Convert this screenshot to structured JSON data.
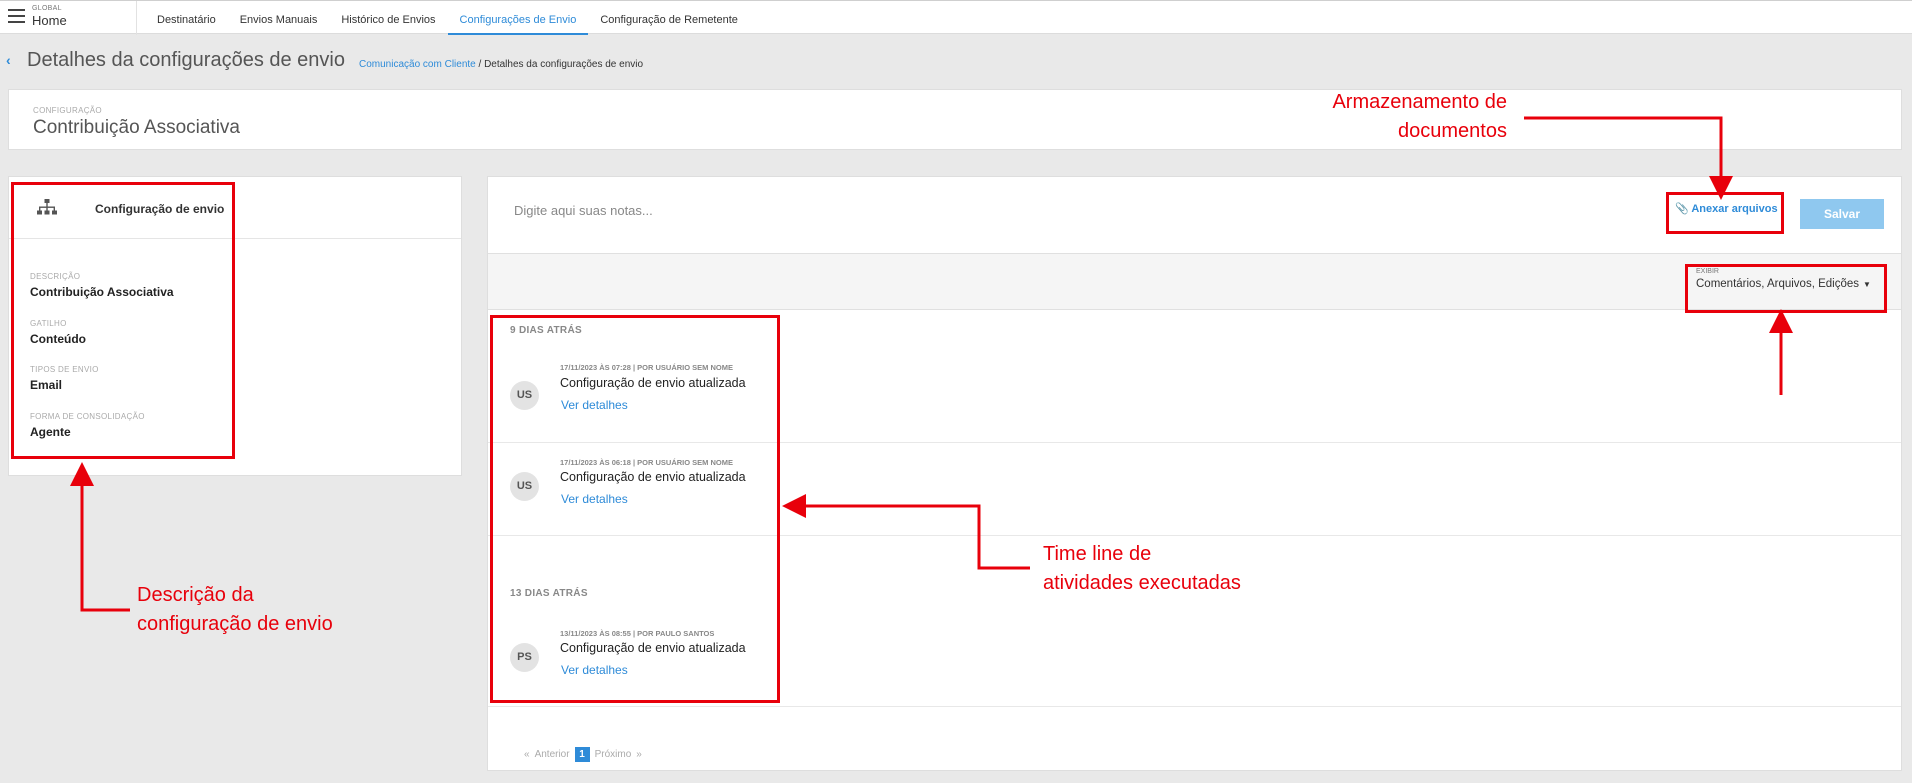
{
  "topbar": {
    "global_label": "GLOBAL",
    "home_label": "Home",
    "tabs": [
      {
        "label": "Destinatário"
      },
      {
        "label": "Envios Manuais"
      },
      {
        "label": "Histórico de Envios"
      },
      {
        "label": "Configurações de Envio",
        "active": true
      },
      {
        "label": "Configuração de Remetente"
      }
    ]
  },
  "page": {
    "title": "Detalhes da configurações de envio",
    "breadcrumb_link": "Comunicação com Cliente",
    "breadcrumb_sep": " / ",
    "breadcrumb_current": "Detalhes da configurações de envio"
  },
  "config": {
    "label": "CONFIGURAÇÃO",
    "value": "Contribuição Associativa"
  },
  "left_card": {
    "title": "Configuração de envio",
    "fields": [
      {
        "label": "DESCRIÇÃO",
        "value": "Contribuição Associativa"
      },
      {
        "label": "GATILHO",
        "value": "Conteúdo"
      },
      {
        "label": "TIPOS DE ENVIO",
        "value": "Email"
      },
      {
        "label": "FORMA DE CONSOLIDAÇÃO",
        "value": "Agente"
      }
    ]
  },
  "right_card": {
    "notes_placeholder": "Digite aqui suas notas...",
    "attach_label": "Anexar arquivos",
    "save_label": "Salvar",
    "filter_label": "EXIBIR",
    "filter_value": "Comentários, Arquivos, Edições",
    "groups": [
      {
        "day": "9 DIAS ATRÁS",
        "entries": [
          {
            "initials": "US",
            "meta": "17/11/2023 ÀS 07:28 | POR USUÁRIO SEM NOME",
            "message": "Configuração de envio atualizada",
            "link": "Ver detalhes"
          },
          {
            "initials": "US",
            "meta": "17/11/2023 ÀS 06:18 | POR USUÁRIO SEM NOME",
            "message": "Configuração de envio atualizada",
            "link": "Ver detalhes"
          }
        ]
      },
      {
        "day": "13 DIAS ATRÁS",
        "entries": [
          {
            "initials": "PS",
            "meta": "13/11/2023 ÀS 08:55 | POR PAULO SANTOS",
            "message": "Configuração de envio atualizada",
            "link": "Ver detalhes"
          }
        ]
      }
    ],
    "pager": {
      "prev": "Anterior",
      "page": "1",
      "next": "Próximo"
    }
  },
  "annotations": {
    "storage_line1": "Armazenamento de",
    "storage_line2": "documentos",
    "timeline_line1": "Time line de",
    "timeline_line2": "atividades executadas",
    "description_line1": "Descrição da",
    "description_line2": "configuração de envio",
    "color": "#e8000b"
  },
  "colors": {
    "accent": "#2e8bd8",
    "save_button": "#8fc8ef"
  }
}
